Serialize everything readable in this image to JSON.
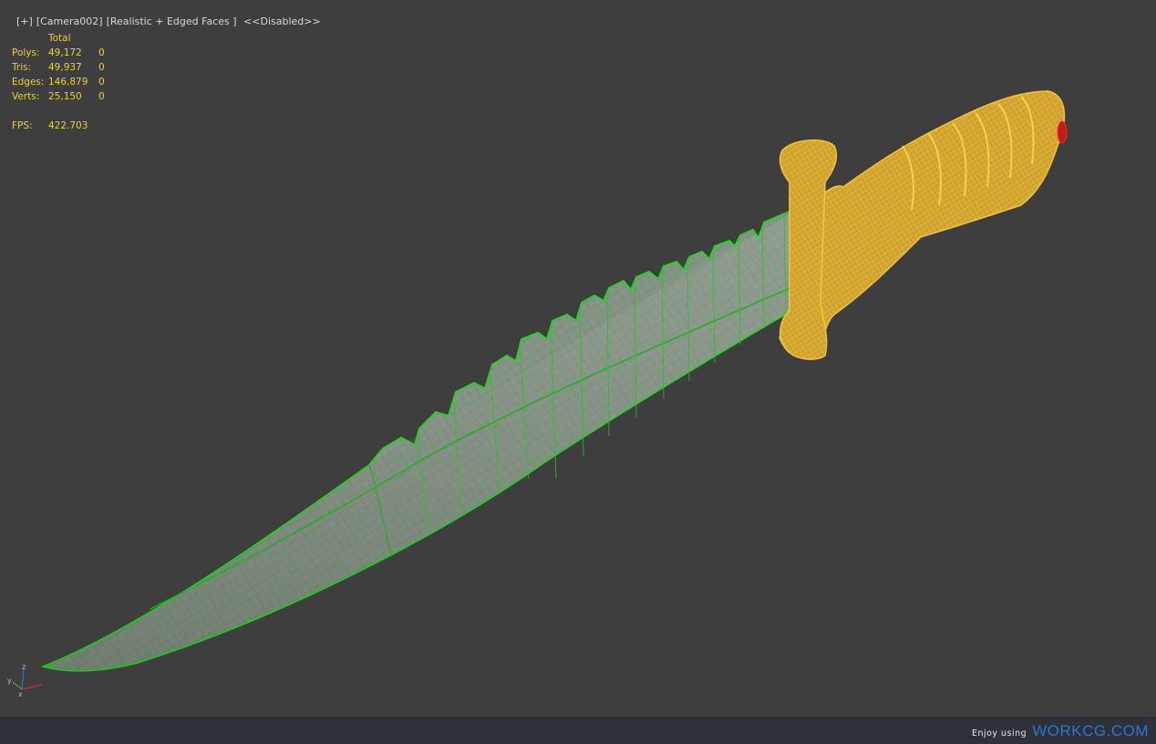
{
  "viewport": {
    "label": {
      "plus": "[+]",
      "camera": "[Camera002]",
      "shading": "[Realistic + Edged Faces ]",
      "status": "<<Disabled>>"
    },
    "stats": {
      "header_total": "Total",
      "rows": [
        {
          "name": "Polys:",
          "total": "49,172",
          "selected": "0"
        },
        {
          "name": "Tris:",
          "total": "49,937",
          "selected": "0"
        },
        {
          "name": "Edges:",
          "total": "146,879",
          "selected": "0"
        },
        {
          "name": "Verts:",
          "total": "25,150",
          "selected": "0"
        }
      ],
      "fps_label": "FPS:",
      "fps_value": "422.703"
    },
    "axis": {
      "z": "z",
      "y": "y",
      "x": "x"
    },
    "colors": {
      "background": "#3e3e3e",
      "stats_text": "#e8d23a",
      "blade_wire": "#22cc22",
      "blade_fill": "#8a8a8a",
      "handle_wire": "#e0b020",
      "handle_fill": "#d4a830",
      "pommel_gem": "#cc1a1a"
    }
  },
  "status_bar": {
    "prefix": "Enjoy using",
    "brand": "WORKCG.COM",
    "brand_color": "#2f74d8"
  }
}
